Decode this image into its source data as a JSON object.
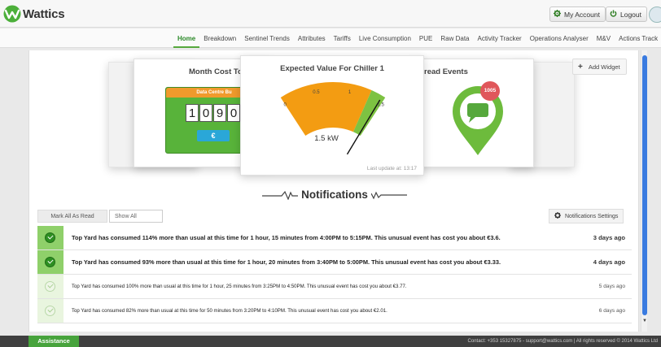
{
  "app": {
    "name": "Wattics",
    "accent": "#56a83c"
  },
  "header": {
    "my_account": "My Account",
    "logout": "Logout"
  },
  "nav": {
    "active": "Home",
    "items": [
      "Home",
      "Breakdown",
      "Sentinel Trends",
      "Attributes",
      "Tariffs",
      "Live Consumption",
      "PUE",
      "Raw Data",
      "Activity Tracker",
      "Operations Analyser",
      "M&V",
      "Actions Track"
    ]
  },
  "widgets": {
    "add_widget": "Add Widget",
    "cost": {
      "title": "Month Cost To",
      "meter_label": "Data Centre Bu",
      "digits": [
        "1",
        "0",
        "9",
        "0"
      ],
      "currency": "€"
    },
    "gauge": {
      "title": "Expected Value For Chiller 1",
      "value": 1.5,
      "value_label": "1.5 kW",
      "min": 0,
      "max": 1.5,
      "ticks": [
        "0",
        "0.5",
        "1",
        "1.5"
      ],
      "last_update": "Last update at: 13:17",
      "colors": {
        "main": "#f39c12",
        "high": "#7dc242"
      }
    },
    "events": {
      "title": "read Events",
      "badge": "1005"
    }
  },
  "notifications": {
    "heading": "Notifications",
    "mark_all_read": "Mark All As Read",
    "show_all": "Show All",
    "settings": "Notifications Settings",
    "items": [
      {
        "text": "Top Yard has consumed 114% more than usual at this time for 1 hour, 15 minutes from 4:00PM to 5:15PM. This unusual event has cost you about €3.6.",
        "when": "3 days ago",
        "unread": true
      },
      {
        "text": "Top Yard has consumed 93% more than usual at this time for 1 hour, 20 minutes from 3:40PM to 5:00PM. This unusual event has cost you about €3.33.",
        "when": "4 days ago",
        "unread": true
      },
      {
        "text": "Top Yard has consumed 100% more than usual at this time for 1 hour, 25 minutes from 3:25PM to 4:50PM. This unusual event has cost you about €3.77.",
        "when": "5 days ago",
        "unread": false
      },
      {
        "text": "Top Yard has consumed 82% more than usual at this time for 50 minutes from 3:20PM to 4:10PM. This unusual event has cost you about €2.01.",
        "when": "6 days ago",
        "unread": false
      }
    ]
  },
  "footer": {
    "assistance": "Assistance",
    "contact": "Contact: +353 15327875 - support@wattics.com | All rights reserved © 2014 Wattics Ltd"
  }
}
